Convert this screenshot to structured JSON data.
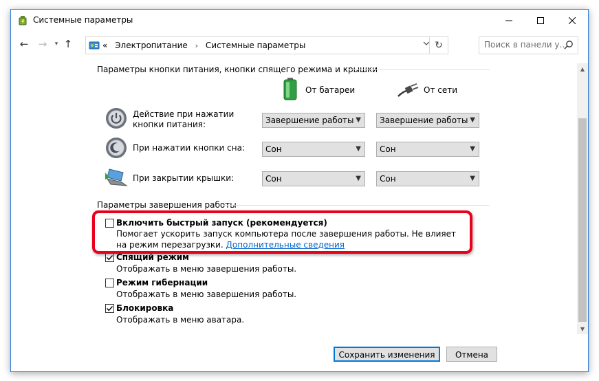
{
  "window": {
    "title": "Системные параметры",
    "icon": "power-options-icon"
  },
  "address": {
    "overflow": "«",
    "crumbs": [
      "Электропитание",
      "Системные параметры"
    ],
    "separator": "›"
  },
  "search": {
    "placeholder": "Поиск в панели у..."
  },
  "power_buttons": {
    "section_title": "Параметры кнопки питания, кнопки спящего режима и крышки",
    "col_battery": "От батареи",
    "col_ac": "От сети",
    "rows": [
      {
        "label": "Действие при нажатии кнопки питания:",
        "battery": "Завершение работы",
        "ac": "Завершение работы",
        "icon": "power-button-icon"
      },
      {
        "label": "При нажатии кнопки сна:",
        "battery": "Сон",
        "ac": "Сон",
        "icon": "sleep-button-icon"
      },
      {
        "label": "При закрытии крышки:",
        "battery": "Сон",
        "ac": "Сон",
        "icon": "laptop-lid-icon"
      }
    ]
  },
  "shutdown": {
    "section_title": "Параметры завершения работы",
    "options": [
      {
        "title": "Включить быстрый запуск (рекомендуется)",
        "checked": false,
        "desc": "Помогает ускорить запуск компьютера после завершения работы. Не влияет на режим перезагрузки. ",
        "link": "Дополнительные сведения"
      },
      {
        "title": "Спящий режим",
        "checked": true,
        "desc": "Отображать в меню завершения работы."
      },
      {
        "title": "Режим гибернации",
        "checked": false,
        "desc": "Отображать в меню завершения работы."
      },
      {
        "title": "Блокировка",
        "checked": true,
        "desc": "Отображать в меню аватара."
      }
    ]
  },
  "buttons": {
    "save": "Сохранить изменения",
    "cancel": "Отмена"
  },
  "colors": {
    "accent": "#0078d7",
    "highlight": "#e8001c",
    "link": "#0066cc"
  }
}
